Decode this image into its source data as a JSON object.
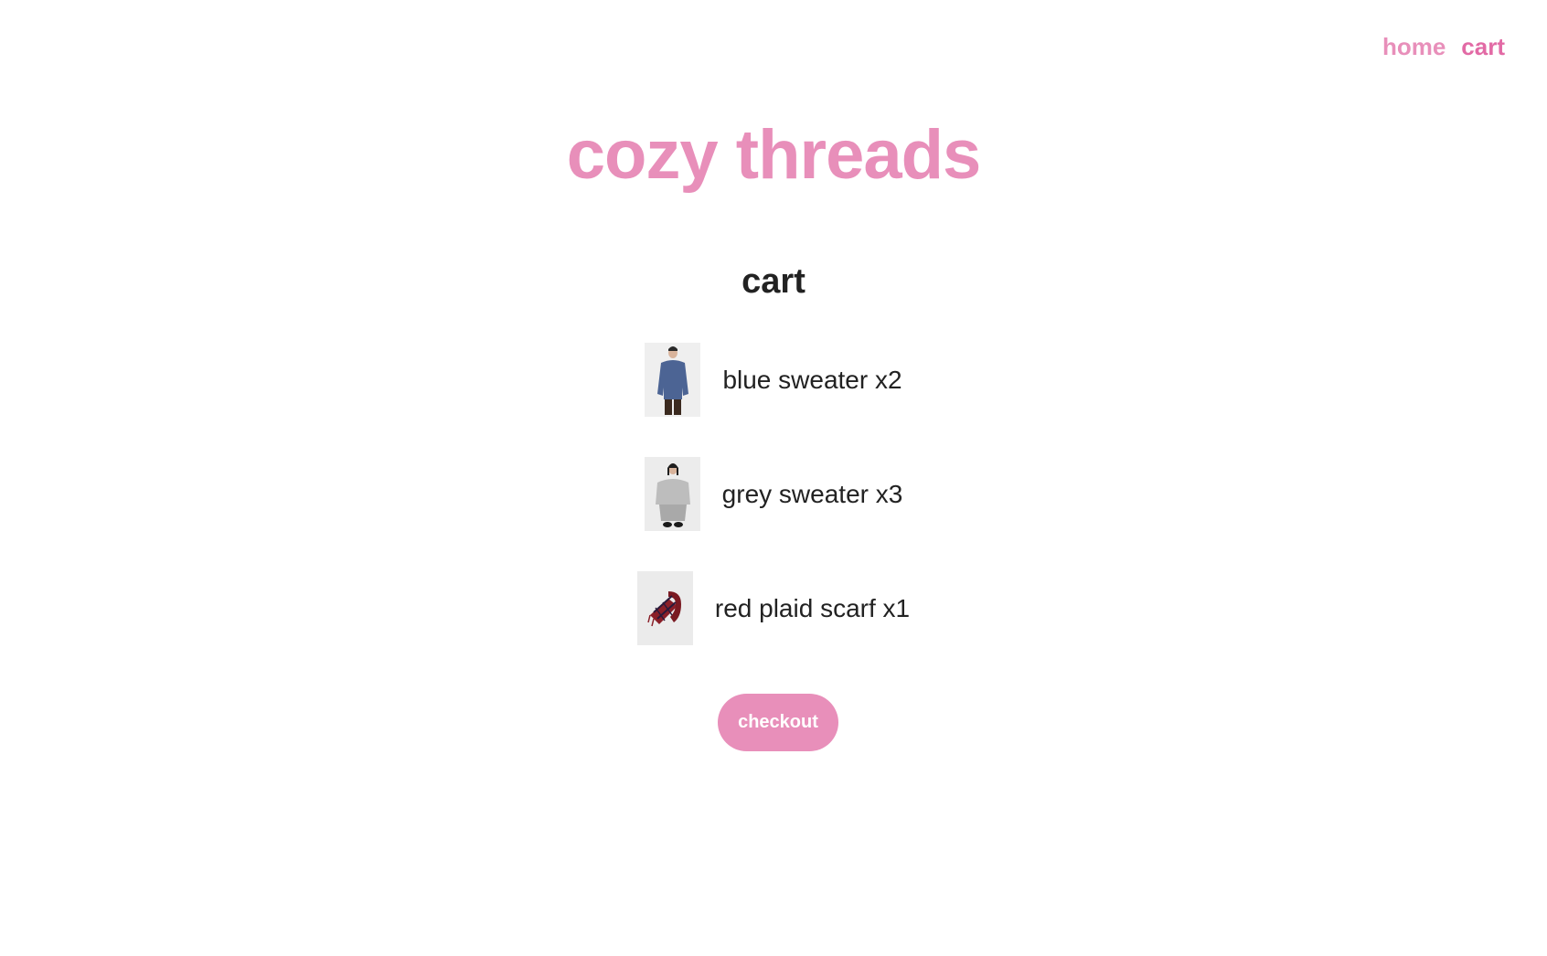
{
  "nav": {
    "items": [
      {
        "label": "home"
      },
      {
        "label": "cart"
      }
    ]
  },
  "brand": {
    "name": "cozy threads",
    "color": "#e88fba"
  },
  "page": {
    "heading": "cart"
  },
  "cart": {
    "items": [
      {
        "label": "blue sweater x2"
      },
      {
        "label": "grey sweater x3"
      },
      {
        "label": "red plaid scarf x1"
      }
    ]
  },
  "checkout": {
    "label": "checkout"
  }
}
